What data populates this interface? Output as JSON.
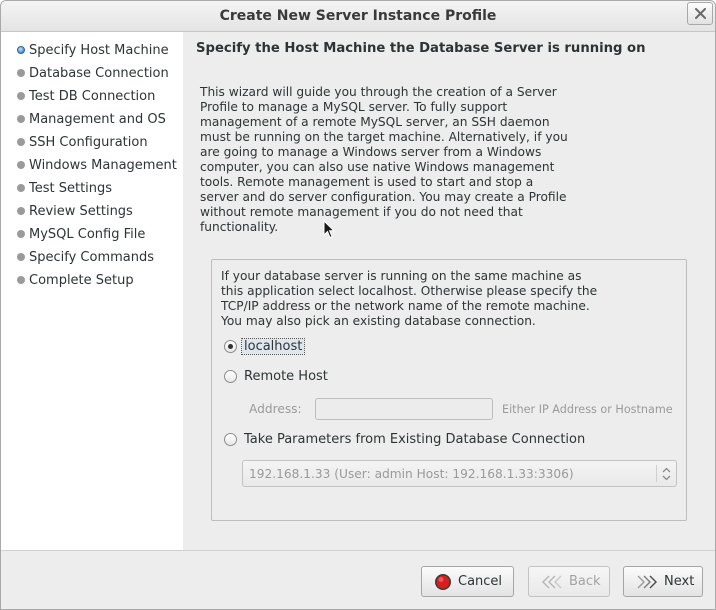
{
  "window": {
    "title": "Create New Server Instance Profile"
  },
  "sidebar": {
    "steps": [
      {
        "label": "Specify Host Machine",
        "active": true
      },
      {
        "label": "Database Connection"
      },
      {
        "label": "Test DB Connection"
      },
      {
        "label": "Management and OS"
      },
      {
        "label": "SSH Configuration"
      },
      {
        "label": "Windows Management"
      },
      {
        "label": "Test Settings"
      },
      {
        "label": "Review Settings"
      },
      {
        "label": "MySQL Config File"
      },
      {
        "label": "Specify Commands"
      },
      {
        "label": "Complete Setup"
      }
    ]
  },
  "main": {
    "heading": "Specify the Host Machine the Database Server is running on",
    "intro_lines": [
      "This wizard will guide you through the creation of a Server",
      "Profile to manage a MySQL server. To fully support",
      "management of a remote MySQL server, an SSH daemon",
      "must be running on the target machine. Alternatively, if you",
      "are going to manage a Windows server from a Windows",
      "computer, you can also use native Windows management",
      "tools. Remote management is used to start and stop a",
      "server and do server configuration. You may create a Profile",
      "without remote management if you do not need that",
      "functionality."
    ],
    "group_text_lines": [
      "If your database server is running on the same machine as",
      "this application select localhost. Otherwise please specify the",
      "TCP/IP address or the network name of the remote machine.",
      "You may also pick an existing database connection."
    ],
    "options": {
      "localhost": "localhost",
      "remote_host": "Remote Host",
      "existing": "Take Parameters from Existing Database Connection",
      "selected": "localhost"
    },
    "address": {
      "label": "Address:",
      "value": "",
      "hint": "Either IP Address or Hostname"
    },
    "connection_select": {
      "value": "192.168.1.33 (User: admin  Host: 192.168.1.33:3306)"
    }
  },
  "buttons": {
    "cancel": "Cancel",
    "back": "Back",
    "next": "Next"
  },
  "colors": {
    "background": "#ededed",
    "sidebar": "#ffffff",
    "active_step": "#4a8bd6",
    "cancel_icon": "#d61f1f"
  }
}
